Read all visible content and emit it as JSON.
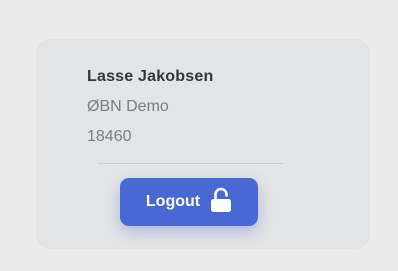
{
  "user": {
    "name": "Lasse Jakobsen",
    "organization": "ØBN Demo",
    "id": "18460"
  },
  "actions": {
    "logout_label": "Logout",
    "logout_icon": "unlock-icon"
  },
  "colors": {
    "background": "#ececec",
    "card": "#e3e4e6",
    "accent": "#4a68d4"
  }
}
